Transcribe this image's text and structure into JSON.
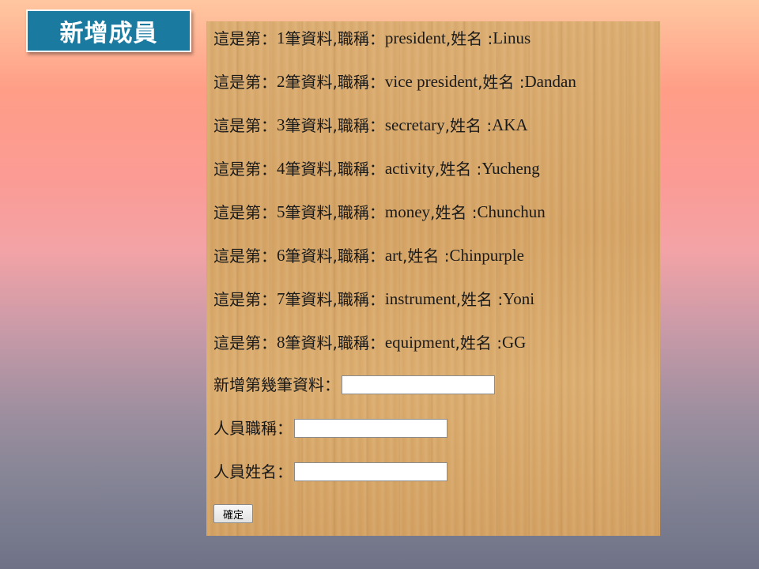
{
  "slide_title": "新增成員",
  "records": [
    {
      "prefix": "這是第：",
      "index": "1",
      "mid": "筆資料,職稱：",
      "title": "president",
      "name_label": ",姓名 : ",
      "name": "Linus"
    },
    {
      "prefix": "這是第：",
      "index": "2",
      "mid": "筆資料,職稱：",
      "title": "vice president",
      "name_label": ",姓名 : ",
      "name": "Dandan"
    },
    {
      "prefix": "這是第：",
      "index": "3",
      "mid": "筆資料,職稱：",
      "title": "secretary",
      "name_label": ",姓名 : ",
      "name": "AKA"
    },
    {
      "prefix": "這是第：",
      "index": "4",
      "mid": "筆資料,職稱：",
      "title": "activity",
      "name_label": ",姓名 : ",
      "name": "Yucheng"
    },
    {
      "prefix": "這是第：",
      "index": "5",
      "mid": "筆資料,職稱：",
      "title": "money",
      "name_label": ",姓名 : ",
      "name": "Chunchun"
    },
    {
      "prefix": "這是第：",
      "index": "6",
      "mid": "筆資料,職稱：",
      "title": "art",
      "name_label": ",姓名 : ",
      "name": "Chinpurple"
    },
    {
      "prefix": "這是第：",
      "index": "7",
      "mid": "筆資料,職稱：",
      "title": "instrument",
      "name_label": ",姓名 : ",
      "name": "Yoni"
    },
    {
      "prefix": "這是第：",
      "index": "8",
      "mid": "筆資料,職稱：",
      "title": "equipment",
      "name_label": ",姓名 : ",
      "name": "GG"
    }
  ],
  "form": {
    "position_label": "新增第幾筆資料：",
    "position_value": "",
    "role_label": "人員職稱：",
    "role_value": "",
    "name_label": "人員姓名：",
    "name_value": "",
    "submit_label": "確定"
  },
  "colors": {
    "title_bg": "#1a7aa0",
    "panel_wood": "#d8a869"
  }
}
